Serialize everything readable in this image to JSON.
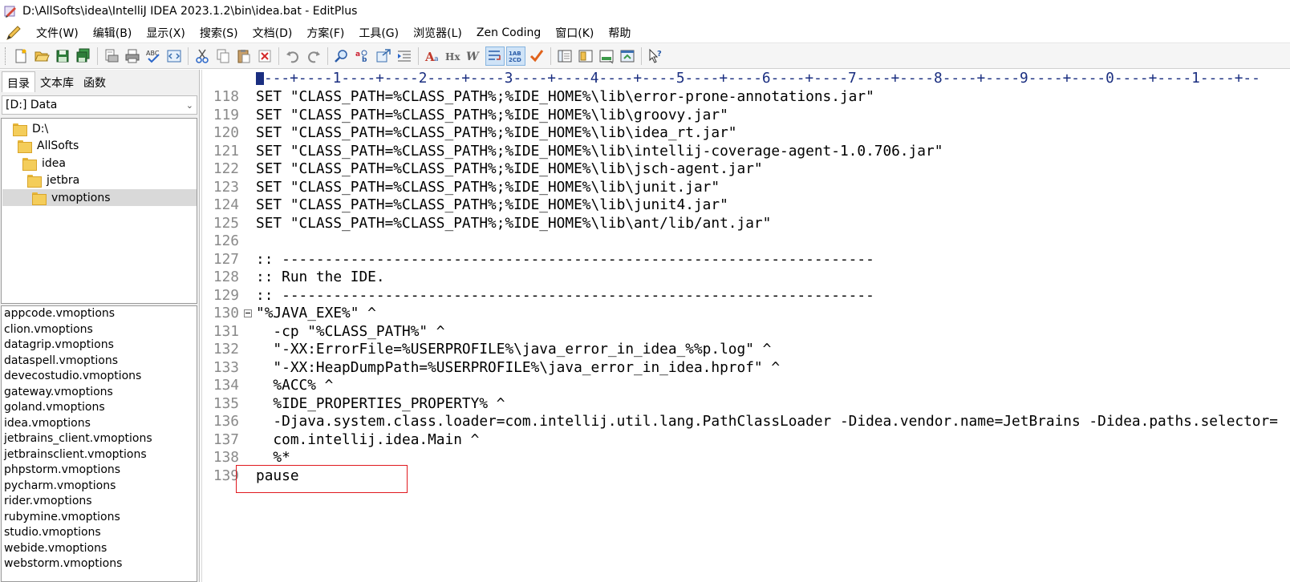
{
  "window": {
    "title": "D:\\AllSofts\\idea\\IntelliJ IDEA 2023.1.2\\bin\\idea.bat - EditPlus"
  },
  "menu": [
    {
      "id": "file",
      "label": "文件(W)"
    },
    {
      "id": "edit",
      "label": "编辑(B)"
    },
    {
      "id": "view",
      "label": "显示(X)"
    },
    {
      "id": "search",
      "label": "搜索(S)"
    },
    {
      "id": "document",
      "label": "文档(D)"
    },
    {
      "id": "project",
      "label": "方案(F)"
    },
    {
      "id": "tools",
      "label": "工具(G)"
    },
    {
      "id": "browser",
      "label": "浏览器(L)"
    },
    {
      "id": "zen",
      "label": "Zen Coding"
    },
    {
      "id": "window",
      "label": "窗口(K)"
    },
    {
      "id": "help",
      "label": "帮助"
    }
  ],
  "toolbar": {
    "icons": [
      "new-file-icon",
      "open-file-icon",
      "save-icon",
      "save-all-icon",
      "print-preview-icon",
      "print-icon",
      "spell-check-icon",
      "html-preview-icon",
      "cut-icon",
      "copy-icon",
      "paste-icon",
      "delete-icon",
      "undo-icon",
      "redo-icon",
      "find-icon",
      "replace-icon",
      "goto-icon",
      "indent-icon",
      "font-icon",
      "hex-icon",
      "word-wrap-icon",
      "line-wrap-icon",
      "line-numbers-icon",
      "check-icon",
      "clip-text-icon",
      "directory-window-icon",
      "output-window-icon",
      "browser-icon",
      "context-help-icon"
    ]
  },
  "left_panel": {
    "tabs": [
      {
        "label": "目录",
        "active": true
      },
      {
        "label": "文本库",
        "active": false
      },
      {
        "label": "函数",
        "active": false
      }
    ],
    "drive": "[D:] Data",
    "tree": [
      {
        "label": "D:\\",
        "indent": 0,
        "selected": false
      },
      {
        "label": "AllSofts",
        "indent": 1,
        "selected": false
      },
      {
        "label": "idea",
        "indent": 2,
        "selected": false
      },
      {
        "label": "jetbra",
        "indent": 3,
        "selected": false
      },
      {
        "label": "vmoptions",
        "indent": 4,
        "selected": true
      }
    ],
    "files": [
      "appcode.vmoptions",
      "clion.vmoptions",
      "datagrip.vmoptions",
      "dataspell.vmoptions",
      "devecostudio.vmoptions",
      "gateway.vmoptions",
      "goland.vmoptions",
      "idea.vmoptions",
      "jetbrains_client.vmoptions",
      "jetbrainsclient.vmoptions",
      "phpstorm.vmoptions",
      "pycharm.vmoptions",
      "rider.vmoptions",
      "rubymine.vmoptions",
      "studio.vmoptions",
      "webide.vmoptions",
      "webstorm.vmoptions"
    ]
  },
  "editor": {
    "ruler": "---+----1----+----2----+----3----+----4----+----5----+----6----+----7----+----8----+----9----+----0----+----1----+--",
    "lines": [
      {
        "num": "118",
        "text": "SET \"CLASS_PATH=%CLASS_PATH%;%IDE_HOME%\\lib\\error-prone-annotations.jar\""
      },
      {
        "num": "119",
        "text": "SET \"CLASS_PATH=%CLASS_PATH%;%IDE_HOME%\\lib\\groovy.jar\""
      },
      {
        "num": "120",
        "text": "SET \"CLASS_PATH=%CLASS_PATH%;%IDE_HOME%\\lib\\idea_rt.jar\""
      },
      {
        "num": "121",
        "text": "SET \"CLASS_PATH=%CLASS_PATH%;%IDE_HOME%\\lib\\intellij-coverage-agent-1.0.706.jar\""
      },
      {
        "num": "122",
        "text": "SET \"CLASS_PATH=%CLASS_PATH%;%IDE_HOME%\\lib\\jsch-agent.jar\""
      },
      {
        "num": "123",
        "text": "SET \"CLASS_PATH=%CLASS_PATH%;%IDE_HOME%\\lib\\junit.jar\""
      },
      {
        "num": "124",
        "text": "SET \"CLASS_PATH=%CLASS_PATH%;%IDE_HOME%\\lib\\junit4.jar\""
      },
      {
        "num": "125",
        "text": "SET \"CLASS_PATH=%CLASS_PATH%;%IDE_HOME%\\lib\\ant/lib/ant.jar\""
      },
      {
        "num": "126",
        "text": ""
      },
      {
        "num": "127",
        "text": ":: ---------------------------------------------------------------------"
      },
      {
        "num": "128",
        "text": ":: Run the IDE."
      },
      {
        "num": "129",
        "text": ":: ---------------------------------------------------------------------"
      },
      {
        "num": "130",
        "text": "\"%JAVA_EXE%\" ^",
        "fold": true
      },
      {
        "num": "131",
        "text": "  -cp \"%CLASS_PATH%\" ^"
      },
      {
        "num": "132",
        "text": "  \"-XX:ErrorFile=%USERPROFILE%\\java_error_in_idea_%%p.log\" ^"
      },
      {
        "num": "133",
        "text": "  \"-XX:HeapDumpPath=%USERPROFILE%\\java_error_in_idea.hprof\" ^"
      },
      {
        "num": "134",
        "text": "  %ACC% ^"
      },
      {
        "num": "135",
        "text": "  %IDE_PROPERTIES_PROPERTY% ^"
      },
      {
        "num": "136",
        "text": "  -Djava.system.class.loader=com.intellij.util.lang.PathClassLoader -Didea.vendor.name=JetBrains -Didea.paths.selector="
      },
      {
        "num": "137",
        "text": "  com.intellij.idea.Main ^"
      },
      {
        "num": "138",
        "text": "  %*"
      },
      {
        "num": "139",
        "text": "pause"
      }
    ]
  },
  "colors": {
    "ruler": "#1a2e80",
    "line_numbers": "#8a8a8a",
    "highlight_box": "#e0191f"
  }
}
